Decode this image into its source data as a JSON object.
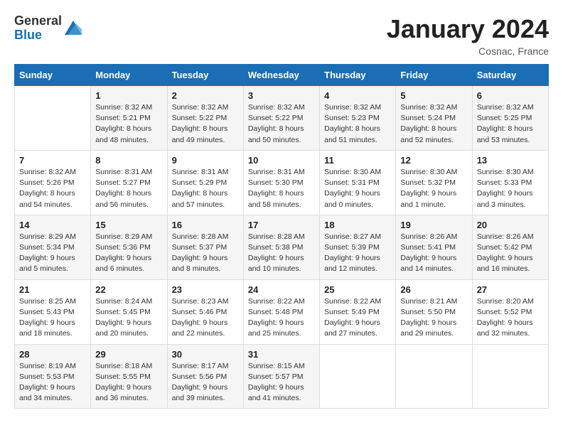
{
  "header": {
    "logo_general": "General",
    "logo_blue": "Blue",
    "month_title": "January 2024",
    "location": "Cosnac, France"
  },
  "days_of_week": [
    "Sunday",
    "Monday",
    "Tuesday",
    "Wednesday",
    "Thursday",
    "Friday",
    "Saturday"
  ],
  "weeks": [
    [
      {
        "day": "",
        "sunrise": "",
        "sunset": "",
        "daylight": ""
      },
      {
        "day": "1",
        "sunrise": "Sunrise: 8:32 AM",
        "sunset": "Sunset: 5:21 PM",
        "daylight": "Daylight: 8 hours and 48 minutes."
      },
      {
        "day": "2",
        "sunrise": "Sunrise: 8:32 AM",
        "sunset": "Sunset: 5:22 PM",
        "daylight": "Daylight: 8 hours and 49 minutes."
      },
      {
        "day": "3",
        "sunrise": "Sunrise: 8:32 AM",
        "sunset": "Sunset: 5:22 PM",
        "daylight": "Daylight: 8 hours and 50 minutes."
      },
      {
        "day": "4",
        "sunrise": "Sunrise: 8:32 AM",
        "sunset": "Sunset: 5:23 PM",
        "daylight": "Daylight: 8 hours and 51 minutes."
      },
      {
        "day": "5",
        "sunrise": "Sunrise: 8:32 AM",
        "sunset": "Sunset: 5:24 PM",
        "daylight": "Daylight: 8 hours and 52 minutes."
      },
      {
        "day": "6",
        "sunrise": "Sunrise: 8:32 AM",
        "sunset": "Sunset: 5:25 PM",
        "daylight": "Daylight: 8 hours and 53 minutes."
      }
    ],
    [
      {
        "day": "7",
        "sunrise": "Sunrise: 8:32 AM",
        "sunset": "Sunset: 5:26 PM",
        "daylight": "Daylight: 8 hours and 54 minutes."
      },
      {
        "day": "8",
        "sunrise": "Sunrise: 8:31 AM",
        "sunset": "Sunset: 5:27 PM",
        "daylight": "Daylight: 8 hours and 56 minutes."
      },
      {
        "day": "9",
        "sunrise": "Sunrise: 8:31 AM",
        "sunset": "Sunset: 5:29 PM",
        "daylight": "Daylight: 8 hours and 57 minutes."
      },
      {
        "day": "10",
        "sunrise": "Sunrise: 8:31 AM",
        "sunset": "Sunset: 5:30 PM",
        "daylight": "Daylight: 8 hours and 58 minutes."
      },
      {
        "day": "11",
        "sunrise": "Sunrise: 8:30 AM",
        "sunset": "Sunset: 5:31 PM",
        "daylight": "Daylight: 9 hours and 0 minutes."
      },
      {
        "day": "12",
        "sunrise": "Sunrise: 8:30 AM",
        "sunset": "Sunset: 5:32 PM",
        "daylight": "Daylight: 9 hours and 1 minute."
      },
      {
        "day": "13",
        "sunrise": "Sunrise: 8:30 AM",
        "sunset": "Sunset: 5:33 PM",
        "daylight": "Daylight: 9 hours and 3 minutes."
      }
    ],
    [
      {
        "day": "14",
        "sunrise": "Sunrise: 8:29 AM",
        "sunset": "Sunset: 5:34 PM",
        "daylight": "Daylight: 9 hours and 5 minutes."
      },
      {
        "day": "15",
        "sunrise": "Sunrise: 8:29 AM",
        "sunset": "Sunset: 5:36 PM",
        "daylight": "Daylight: 9 hours and 6 minutes."
      },
      {
        "day": "16",
        "sunrise": "Sunrise: 8:28 AM",
        "sunset": "Sunset: 5:37 PM",
        "daylight": "Daylight: 9 hours and 8 minutes."
      },
      {
        "day": "17",
        "sunrise": "Sunrise: 8:28 AM",
        "sunset": "Sunset: 5:38 PM",
        "daylight": "Daylight: 9 hours and 10 minutes."
      },
      {
        "day": "18",
        "sunrise": "Sunrise: 8:27 AM",
        "sunset": "Sunset: 5:39 PM",
        "daylight": "Daylight: 9 hours and 12 minutes."
      },
      {
        "day": "19",
        "sunrise": "Sunrise: 8:26 AM",
        "sunset": "Sunset: 5:41 PM",
        "daylight": "Daylight: 9 hours and 14 minutes."
      },
      {
        "day": "20",
        "sunrise": "Sunrise: 8:26 AM",
        "sunset": "Sunset: 5:42 PM",
        "daylight": "Daylight: 9 hours and 16 minutes."
      }
    ],
    [
      {
        "day": "21",
        "sunrise": "Sunrise: 8:25 AM",
        "sunset": "Sunset: 5:43 PM",
        "daylight": "Daylight: 9 hours and 18 minutes."
      },
      {
        "day": "22",
        "sunrise": "Sunrise: 8:24 AM",
        "sunset": "Sunset: 5:45 PM",
        "daylight": "Daylight: 9 hours and 20 minutes."
      },
      {
        "day": "23",
        "sunrise": "Sunrise: 8:23 AM",
        "sunset": "Sunset: 5:46 PM",
        "daylight": "Daylight: 9 hours and 22 minutes."
      },
      {
        "day": "24",
        "sunrise": "Sunrise: 8:22 AM",
        "sunset": "Sunset: 5:48 PM",
        "daylight": "Daylight: 9 hours and 25 minutes."
      },
      {
        "day": "25",
        "sunrise": "Sunrise: 8:22 AM",
        "sunset": "Sunset: 5:49 PM",
        "daylight": "Daylight: 9 hours and 27 minutes."
      },
      {
        "day": "26",
        "sunrise": "Sunrise: 8:21 AM",
        "sunset": "Sunset: 5:50 PM",
        "daylight": "Daylight: 9 hours and 29 minutes."
      },
      {
        "day": "27",
        "sunrise": "Sunrise: 8:20 AM",
        "sunset": "Sunset: 5:52 PM",
        "daylight": "Daylight: 9 hours and 32 minutes."
      }
    ],
    [
      {
        "day": "28",
        "sunrise": "Sunrise: 8:19 AM",
        "sunset": "Sunset: 5:53 PM",
        "daylight": "Daylight: 9 hours and 34 minutes."
      },
      {
        "day": "29",
        "sunrise": "Sunrise: 8:18 AM",
        "sunset": "Sunset: 5:55 PM",
        "daylight": "Daylight: 9 hours and 36 minutes."
      },
      {
        "day": "30",
        "sunrise": "Sunrise: 8:17 AM",
        "sunset": "Sunset: 5:56 PM",
        "daylight": "Daylight: 9 hours and 39 minutes."
      },
      {
        "day": "31",
        "sunrise": "Sunrise: 8:15 AM",
        "sunset": "Sunset: 5:57 PM",
        "daylight": "Daylight: 9 hours and 41 minutes."
      },
      {
        "day": "",
        "sunrise": "",
        "sunset": "",
        "daylight": ""
      },
      {
        "day": "",
        "sunrise": "",
        "sunset": "",
        "daylight": ""
      },
      {
        "day": "",
        "sunrise": "",
        "sunset": "",
        "daylight": ""
      }
    ]
  ]
}
